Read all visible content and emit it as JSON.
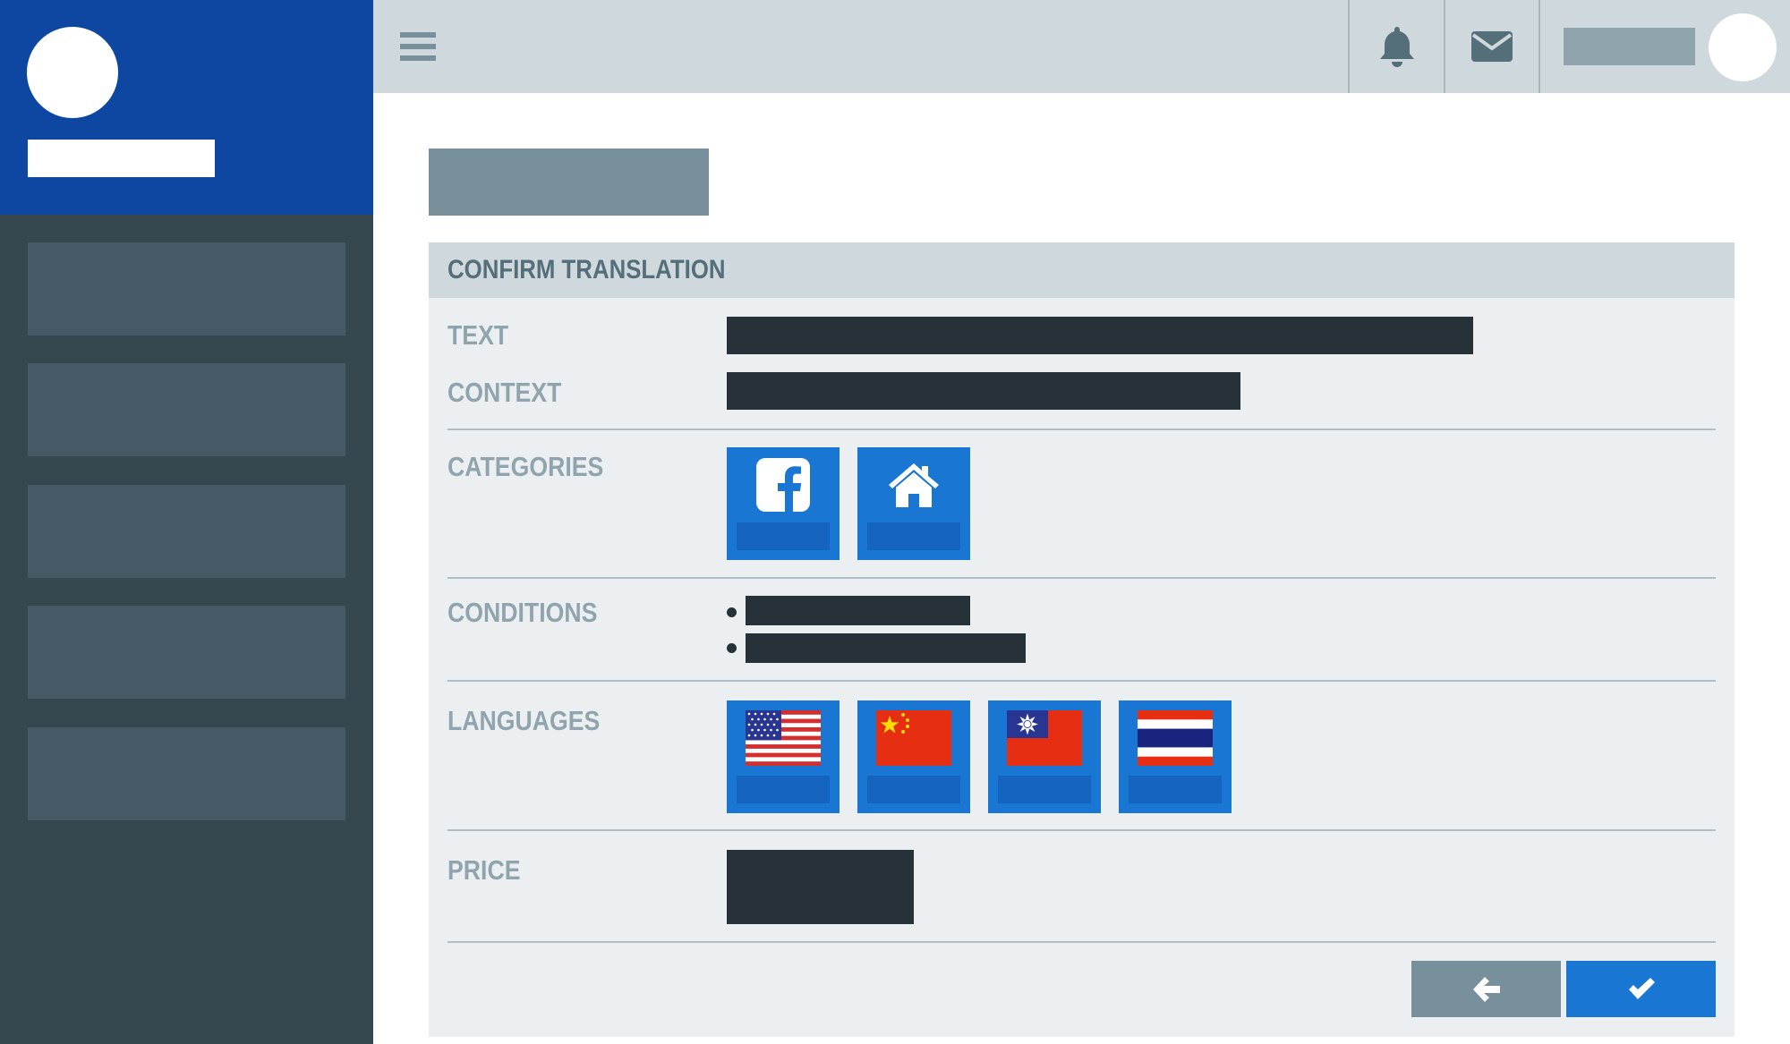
{
  "sidebar": {
    "items": [
      {
        "label": ""
      },
      {
        "label": ""
      },
      {
        "label": ""
      },
      {
        "label": ""
      },
      {
        "label": ""
      }
    ]
  },
  "topbar": {
    "icons": [
      "menu-icon",
      "bell-icon",
      "mail-icon"
    ]
  },
  "card": {
    "title": "CONFIRM TRANSLATION",
    "labels": {
      "text": "TEXT",
      "context": "CONTEXT",
      "categories": "CATEGORIES",
      "conditions": "CONDITIONS",
      "languages": "LANGUAGES",
      "price": "PRICE"
    },
    "categories": [
      "facebook-icon",
      "home-icon"
    ],
    "languages": [
      "flag-us",
      "flag-china",
      "flag-taiwan",
      "flag-thailand"
    ]
  },
  "actions": {
    "back_icon": "arrow-left-icon",
    "confirm_icon": "check-icon"
  },
  "colors": {
    "brand": "#0d47a1",
    "accent": "#1976d2",
    "sidebar": "#37474f",
    "redacted": "#263238"
  }
}
